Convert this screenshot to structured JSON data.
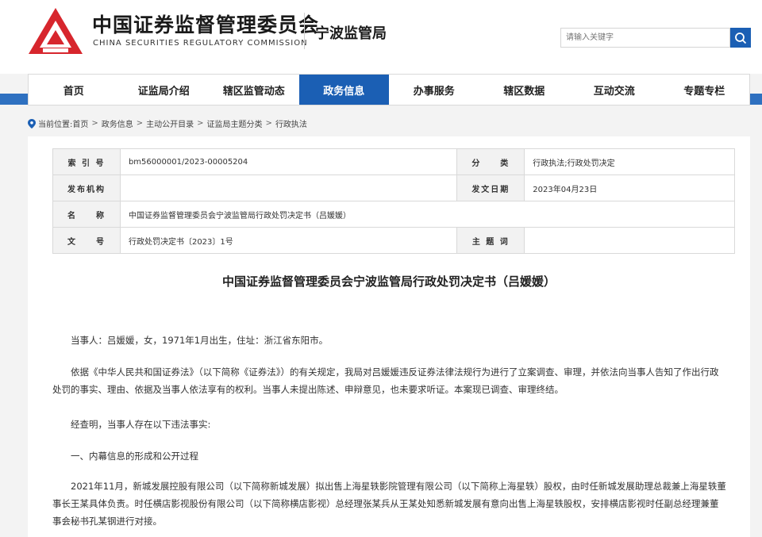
{
  "header": {
    "org_cn": "中国证券监督管理委员会",
    "org_en": "CHINA SECURITIES REGULATORY COMMISSION",
    "bureau": "宁波监管局",
    "search_placeholder": "请输入关键字",
    "logo_color": "#d7262d",
    "accent": "#1b5fb4"
  },
  "nav": {
    "items": [
      "首页",
      "证监局介绍",
      "辖区监管动态",
      "政务信息",
      "办事服务",
      "辖区数据",
      "互动交流",
      "专题专栏"
    ],
    "active_index": 3
  },
  "breadcrumb": {
    "label": "当前位置:",
    "items": [
      "首页",
      "政务信息",
      "主动公开目录",
      "证监局主题分类",
      "行政执法"
    ]
  },
  "meta": {
    "index_label": "索 引 号",
    "index_value": "bm56000001/2023-00005204",
    "category_label": "分　　类",
    "category_value": "行政执法;行政处罚决定",
    "publisher_label": "发布机构",
    "publisher_value": "",
    "date_label": "发文日期",
    "date_value": "2023年04月23日",
    "name_label": "名　　称",
    "name_value": "中国证券监督管理委员会宁波监管局行政处罚决定书（吕媛媛）",
    "docno_label": "文　　号",
    "docno_value": "行政处罚决定书〔2023〕1号",
    "keywords_label": "主 题 词",
    "keywords_value": ""
  },
  "document": {
    "title": "中国证券监督管理委员会宁波监管局行政处罚决定书（吕媛媛）",
    "paragraphs": [
      "当事人：吕媛媛，女，1971年1月出生，住址：浙江省东阳市。",
      "依据《中华人民共和国证券法》（以下简称《证券法》）的有关规定，我局对吕媛媛违反证券法律法规行为进行了立案调查、审理，并依法向当事人告知了作出行政处罚的事实、理由、依据及当事人依法享有的权利。当事人未提出陈述、申辩意见，也未要求听证。本案现已调查、审理终结。",
      "经查明，当事人存在以下违法事实:",
      "一、内幕信息的形成和公开过程",
      "2021年11月，新城发展控股有限公司（以下简称新城发展）拟出售上海星轶影院管理有限公司（以下简称上海星轶）股权，由时任新城发展助理总裁兼上海星轶董事长王某具体负责。时任横店影视股份有限公司（以下简称横店影视）总经理张某兵从王某处知悉新城发展有意向出售上海星轶股权，安排横店影视时任副总经理兼董事会秘书孔某钢进行对接。"
    ]
  }
}
